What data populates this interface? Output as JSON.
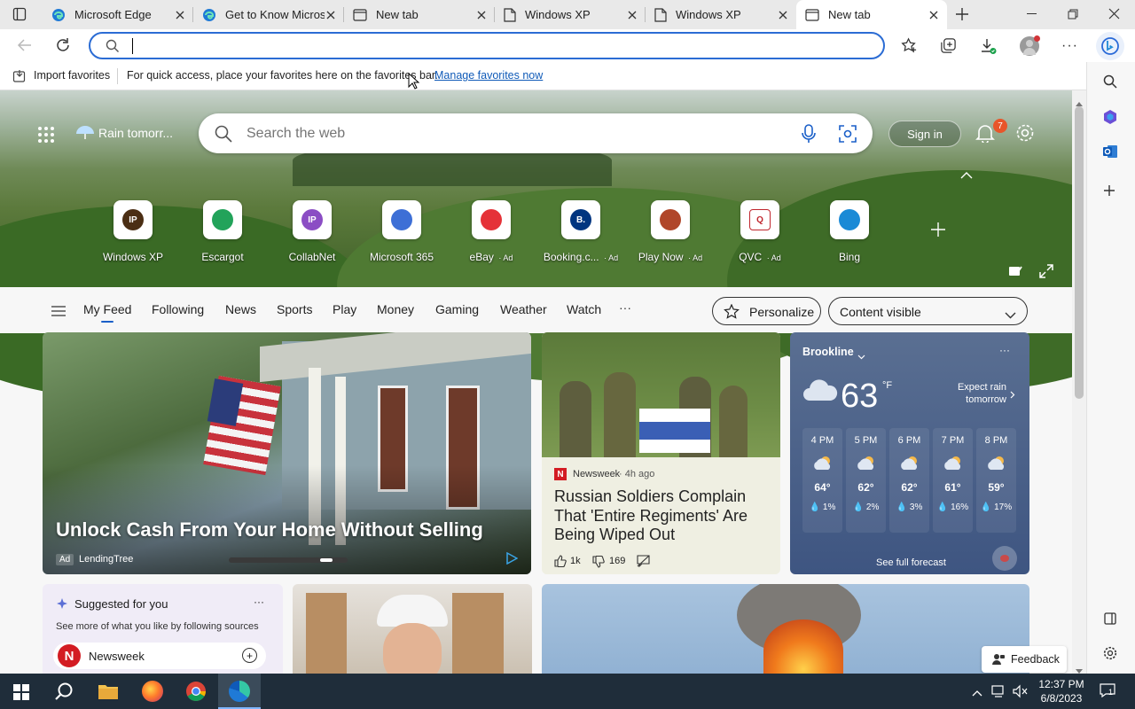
{
  "tabs": [
    {
      "label": "Microsoft Edge",
      "icon": "edge-icon"
    },
    {
      "label": "Get to Know Micros",
      "icon": "edge-icon"
    },
    {
      "label": "New tab",
      "icon": "page-icon"
    },
    {
      "label": "Windows XP",
      "icon": "document-icon"
    },
    {
      "label": "Windows XP",
      "icon": "document-icon"
    },
    {
      "label": "New tab",
      "icon": "page-icon",
      "active": true
    }
  ],
  "address": {
    "value": "",
    "placeholder": ""
  },
  "favbar": {
    "import_label": "Import favorites",
    "message": "For quick access, place your favorites here on the favorites bar.",
    "manage_link": "Manage favorites now"
  },
  "hero": {
    "weather_short": "Rain tomorr...",
    "search_placeholder": "Search the web",
    "signin_label": "Sign in",
    "notif_count": "7",
    "tiles": [
      {
        "name": "Windows XP",
        "badge": "IP",
        "color": "#4b2e14"
      },
      {
        "name": "Escargot",
        "badge": "",
        "color": "#22a35a"
      },
      {
        "name": "CollabNet",
        "badge": "IP",
        "color": "#8b4dc4"
      },
      {
        "name": "Microsoft 365",
        "badge": "",
        "color": "#3d6fd6"
      },
      {
        "name": "eBay",
        "ad": "Ad",
        "badge": "",
        "color": "#e53238"
      },
      {
        "name": "Booking.c...",
        "ad": "Ad",
        "badge": "B.",
        "color": "#003580"
      },
      {
        "name": "Play Now",
        "ad": "Ad",
        "badge": "",
        "color": "#b0462a"
      },
      {
        "name": "QVC",
        "ad": "Ad",
        "badge": "Q",
        "color": "#444444"
      },
      {
        "name": "Bing",
        "badge": "",
        "color": "#1a8ad6"
      }
    ]
  },
  "feednav": {
    "items": [
      "My Feed",
      "Following",
      "News",
      "Sports",
      "Play",
      "Money",
      "Gaming",
      "Weather",
      "Watch"
    ],
    "more": "···",
    "personalize": "Personalize",
    "content_visible": "Content visible"
  },
  "cards": {
    "main": {
      "headline": "Unlock Cash From Your Home Without Selling",
      "ad": "Ad",
      "source": "LendingTree"
    },
    "news": {
      "source": "Newsweek",
      "age": "· 4h ago",
      "headline": "Russian Soldiers Complain That 'Entire Regiments' Are Being Wiped Out",
      "likes": "1k",
      "dislikes": "169"
    },
    "weather": {
      "location": "Brookline",
      "temp": "63",
      "unit": "°F",
      "expect": "Expect rain tomorrow",
      "hours": [
        {
          "time": "4 PM",
          "temp": "64°",
          "rain": "1%"
        },
        {
          "time": "5 PM",
          "temp": "62°",
          "rain": "2%"
        },
        {
          "time": "6 PM",
          "temp": "62°",
          "rain": "3%"
        },
        {
          "time": "7 PM",
          "temp": "61°",
          "rain": "16%"
        },
        {
          "time": "8 PM",
          "temp": "59°",
          "rain": "17%"
        }
      ],
      "forecast_link": "See full forecast"
    },
    "suggested": {
      "title": "Suggested for you",
      "subtitle": "See more of what you like by following sources",
      "source": "Newsweek"
    },
    "feedback": "Feedback"
  },
  "taskbar": {
    "time": "12:37 PM",
    "date": "6/8/2023",
    "notif": "1"
  }
}
